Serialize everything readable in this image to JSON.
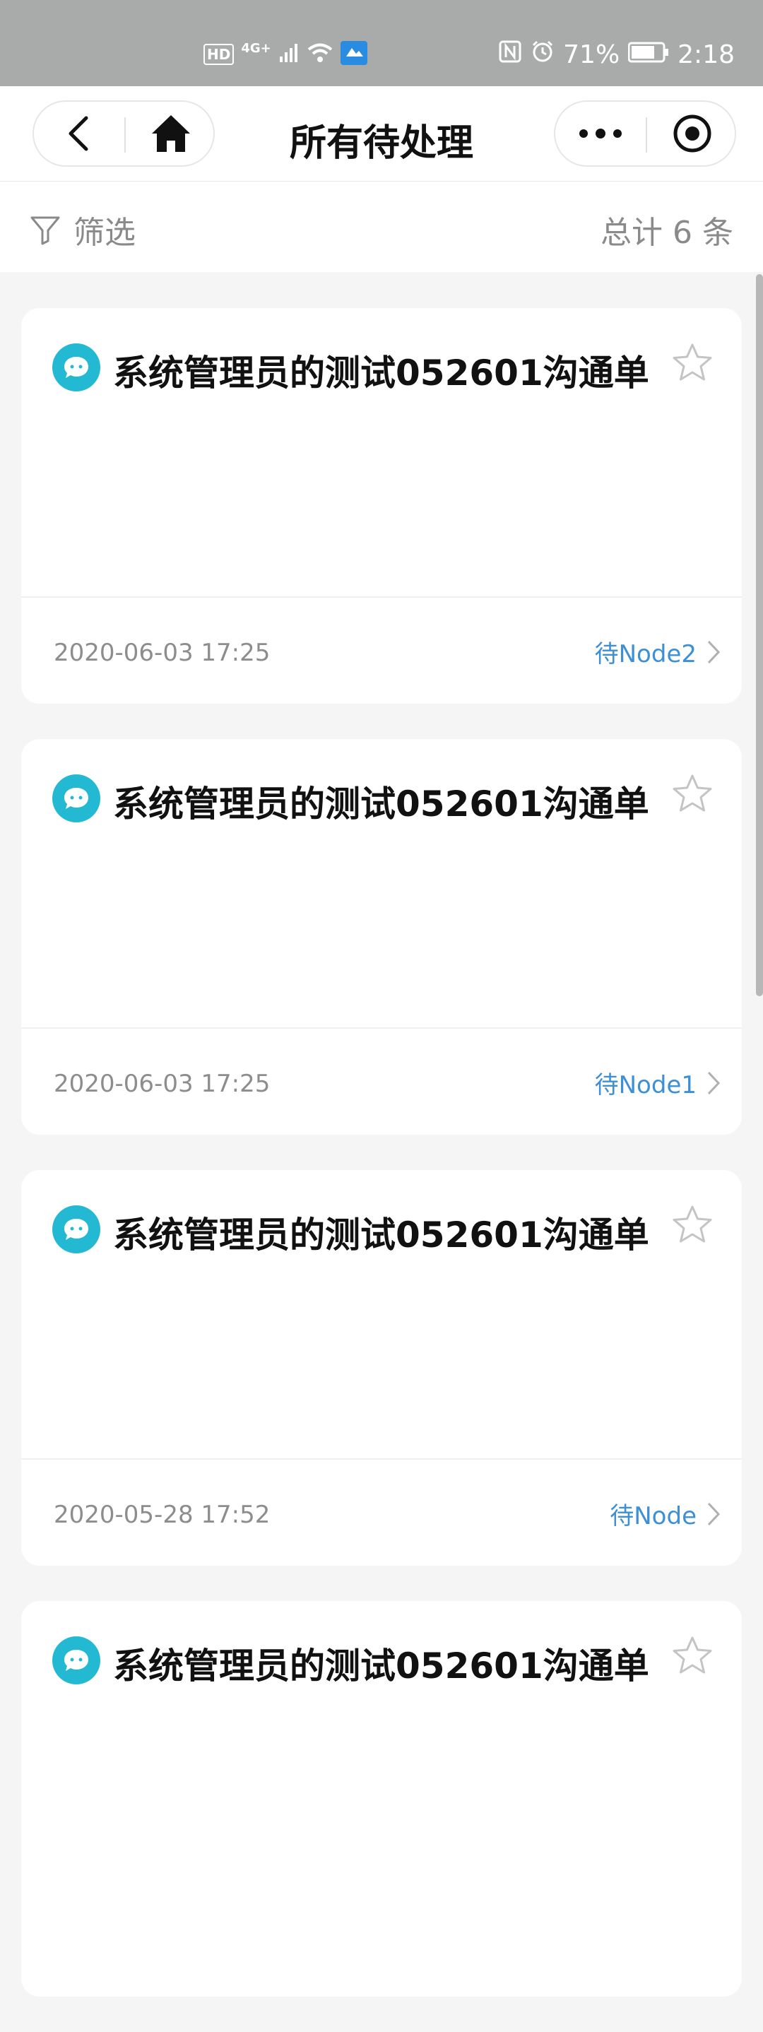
{
  "status_bar": {
    "hd": "HD",
    "network": "4G+",
    "battery": "71%",
    "time": "2:18"
  },
  "header": {
    "title": "所有待处理"
  },
  "filter": {
    "label": "筛选",
    "total": "总计 6 条"
  },
  "cards": [
    {
      "title": "系统管理员的测试052601沟通单",
      "time": "2020-06-03 17:25",
      "status": "待Node2"
    },
    {
      "title": "系统管理员的测试052601沟通单",
      "time": "2020-06-03 17:25",
      "status": "待Node1"
    },
    {
      "title": "系统管理员的测试052601沟通单",
      "time": "2020-05-28 17:52",
      "status": "待Node"
    },
    {
      "title": "系统管理员的测试052601沟通单",
      "time": "",
      "status": ""
    }
  ],
  "colors": {
    "accent": "#3d8fd6",
    "icon_bg": "#24b9d3",
    "status_bar_bg": "#a9abaa"
  }
}
